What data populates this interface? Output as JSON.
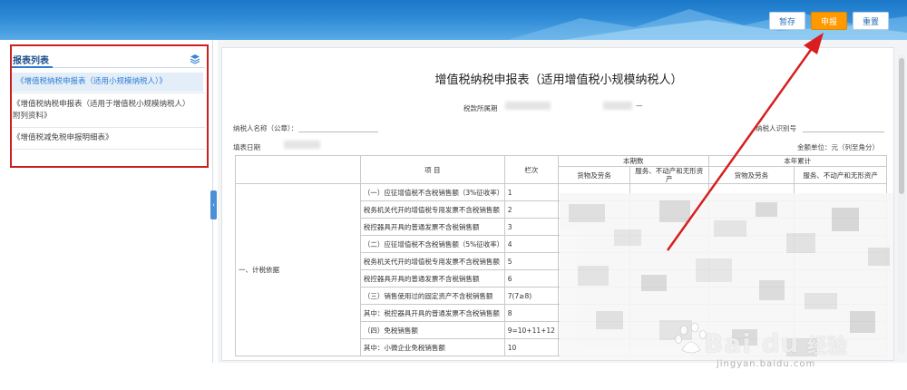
{
  "toolbar": {
    "save": "暂存",
    "submit": "申报",
    "reset": "重置"
  },
  "sidebar": {
    "title": "报表列表",
    "items": [
      "《增值税纳税申报表（适用小规模纳税人）》",
      "《增值税纳税申报表（适用于增值税小规模纳税人）附列资料》",
      "《增值税减免税申报明细表》"
    ]
  },
  "form": {
    "title": "增值税纳税申报表（适用增值税小规模纳税人）",
    "period_label": "税款所属期",
    "period_sep": "—",
    "taxpayer_name_label": "纳税人名称（公章）：",
    "taxpayer_id_label": "纳税人识别号",
    "fill_date_label": "填表日期",
    "unit_label": "金额单位：元（列至角分）",
    "headers": {
      "item": "项  目",
      "col": "栏次",
      "current": "本期数",
      "ytd": "本年累计",
      "goods": "货物及劳务",
      "services": "服务、不动产和无形资产"
    },
    "section": "一、计税依据",
    "rows": [
      {
        "item": "（一）应征增值税不含税销售额（3%征收率）",
        "col": "1"
      },
      {
        "item": "税务机关代开的增值税专用发票不含税销售额",
        "col": "2"
      },
      {
        "item": "税控器具开具的普通发票不含税销售额",
        "col": "3"
      },
      {
        "item": "（二）应征增值税不含税销售额（5%征收率）",
        "col": "4"
      },
      {
        "item": "税务机关代开的增值税专用发票不含税销售额",
        "col": "5"
      },
      {
        "item": "税控器具开具的普通发票不含税销售额",
        "col": "6"
      },
      {
        "item": "（三）销售使用过的固定资产不含税销售额",
        "col": "7(7≥8)"
      },
      {
        "item": "其中：税控器具开具的普通发票不含税销售额",
        "col": "8"
      },
      {
        "item": "（四）免税销售额",
        "col": "9=10+11+12"
      },
      {
        "item": "其中：小微企业免税销售额",
        "col": "10"
      }
    ]
  },
  "watermark": {
    "brand": "Bai du",
    "cn": "经验",
    "url": "jingyan.baidu.com"
  },
  "colors": {
    "header": "#2e8ad6",
    "submit": "#ff9900",
    "highlight": "#cc2020",
    "accent": "#2f7cd3"
  }
}
